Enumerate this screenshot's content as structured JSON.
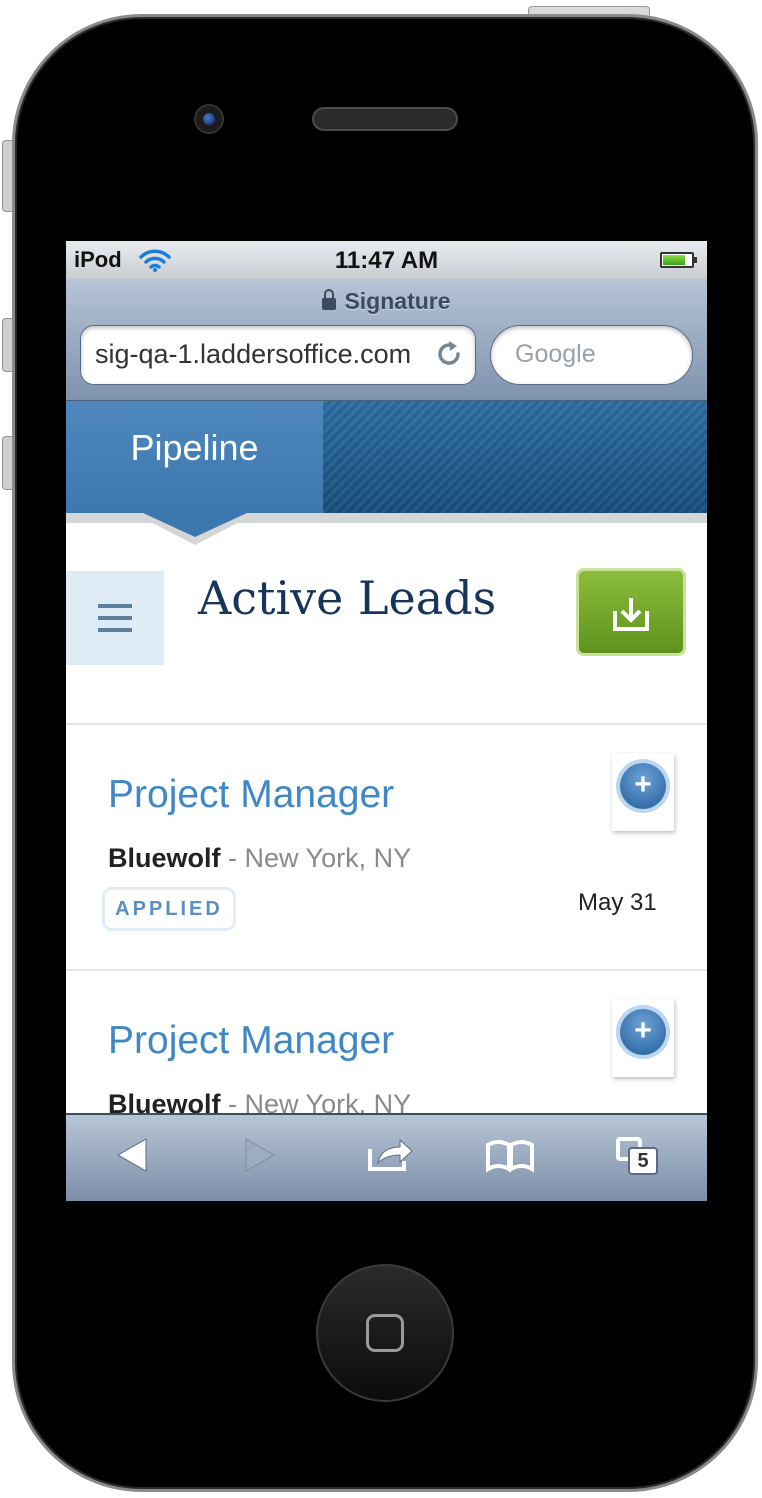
{
  "status_bar": {
    "carrier": "iPod",
    "time": "11:47 AM"
  },
  "browser": {
    "page_title": "Signature",
    "address": "sig-qa-1.laddersoffice.com",
    "search_placeholder": "Google",
    "tab_count": "5"
  },
  "nav": {
    "active_tab": "Pipeline"
  },
  "page": {
    "heading": "Active Leads"
  },
  "leads": [
    {
      "title": "Project Manager",
      "company": "Bluewolf",
      "separator": "-",
      "location": "New York, NY",
      "status": "APPLIED",
      "date": "May 31"
    },
    {
      "title": "Project Manager",
      "company": "Bluewolf",
      "separator": "-",
      "location": "New York, NY"
    }
  ],
  "colors": {
    "accent": "#3f88c5",
    "heading": "#17355a",
    "download_button": "#6fa02a",
    "nav_blue": "#3c77ae"
  },
  "icons": [
    "wifi-icon",
    "battery-icon",
    "lock-icon",
    "reload-icon",
    "menu-icon",
    "download-icon",
    "add-icon",
    "back-icon",
    "forward-icon",
    "share-icon",
    "bookmarks-icon",
    "tabs-icon"
  ]
}
